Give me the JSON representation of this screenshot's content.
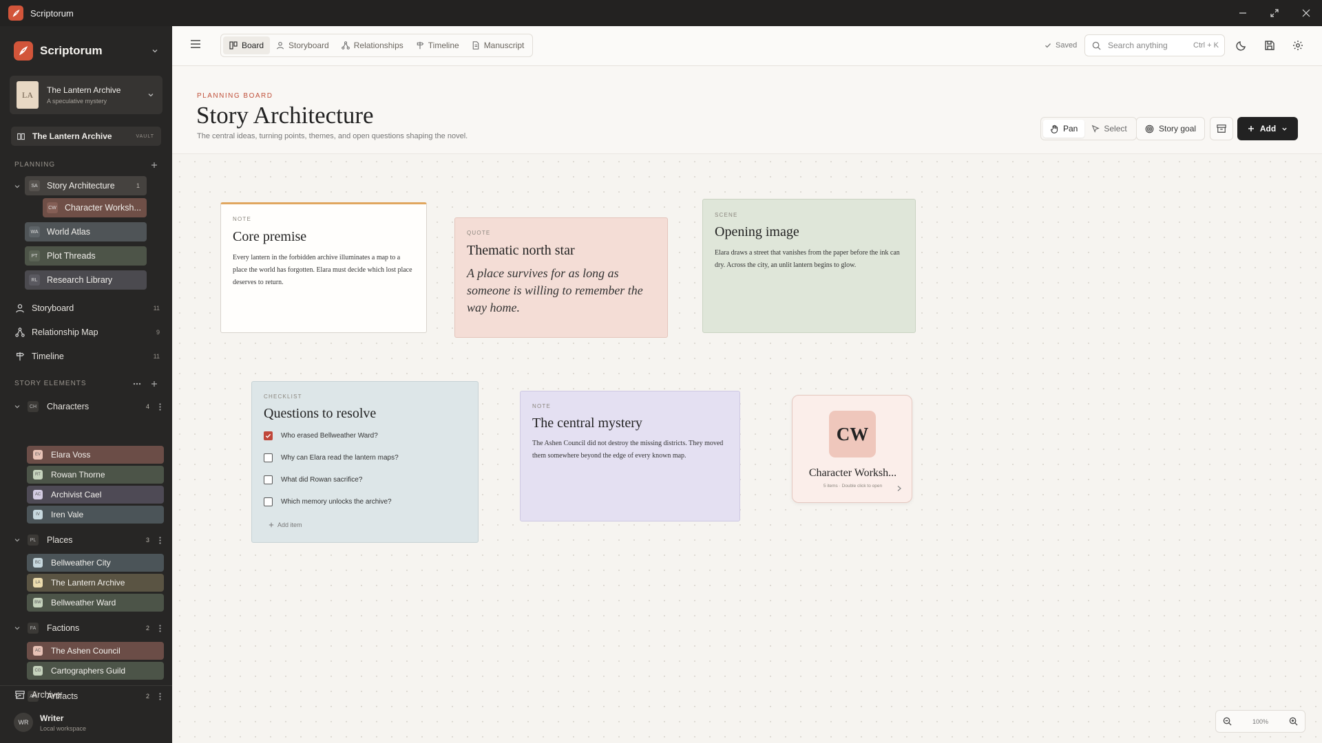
{
  "app": {
    "name": "Scriptorum"
  },
  "sidebar": {
    "brand": "Scriptorum",
    "project": {
      "initials": "LA",
      "title": "The Lantern Archive",
      "subtitle": "A speculative mystery"
    },
    "vault": {
      "label": "The Lantern Archive",
      "tag": "VAULT"
    },
    "planning": {
      "heading": "PLANNING",
      "root": {
        "initials": "SA",
        "label": "Story Architecture",
        "count": "1"
      },
      "child": {
        "initials": "CW",
        "label": "Character Worksh..."
      },
      "boards": [
        {
          "initials": "WA",
          "label": "World Atlas"
        },
        {
          "initials": "PT",
          "label": "Plot Threads"
        },
        {
          "initials": "RL",
          "label": "Research Library"
        }
      ]
    },
    "nav": [
      {
        "label": "Storyboard",
        "count": "11"
      },
      {
        "label": "Relationship Map",
        "count": "9"
      },
      {
        "label": "Timeline",
        "count": "11"
      }
    ],
    "story_elements": {
      "heading": "STORY ELEMENTS",
      "characters": {
        "initials": "CH",
        "label": "Characters",
        "count": "4",
        "items": [
          {
            "initials": "EV",
            "label": "Elara Voss"
          },
          {
            "initials": "RT",
            "label": "Rowan Thorne"
          },
          {
            "initials": "AC",
            "label": "Archivist Cael"
          },
          {
            "initials": "IV",
            "label": "Iren Vale"
          }
        ]
      },
      "places": {
        "initials": "PL",
        "label": "Places",
        "count": "3",
        "items": [
          {
            "initials": "BC",
            "label": "Bellweather City"
          },
          {
            "initials": "LA",
            "label": "The Lantern Archive"
          },
          {
            "initials": "BW",
            "label": "Bellweather Ward"
          }
        ]
      },
      "factions": {
        "initials": "FA",
        "label": "Factions",
        "count": "2",
        "items": [
          {
            "initials": "AC",
            "label": "The Ashen Council"
          },
          {
            "initials": "CG",
            "label": "Cartographers Guild"
          }
        ]
      },
      "artifacts": {
        "initials": "AR",
        "label": "Artifacts",
        "count": "2"
      }
    },
    "archive": "Archive",
    "user": {
      "initials": "WR",
      "name": "Writer",
      "workspace": "Local workspace"
    }
  },
  "toolbar": {
    "tabs": [
      {
        "label": "Board",
        "icon": "board-icon"
      },
      {
        "label": "Storyboard",
        "icon": "person-icon"
      },
      {
        "label": "Relationships",
        "icon": "network-icon"
      },
      {
        "label": "Timeline",
        "icon": "signpost-icon"
      },
      {
        "label": "Manuscript",
        "icon": "document-icon"
      }
    ],
    "saved": "Saved",
    "search_placeholder": "Search anything",
    "search_shortcut": "Ctrl + K"
  },
  "header": {
    "eyebrow": "PLANNING BOARD",
    "title": "Story Architecture",
    "subtitle": "The central ideas, turning points, themes, and open questions shaping the novel.",
    "pan": "Pan",
    "select": "Select",
    "story_goal": "Story goal",
    "add": "Add"
  },
  "cards": {
    "core_premise": {
      "kind": "NOTE",
      "title": "Core premise",
      "body": "Every lantern in the forbidden archive illuminates a map to a place the world has forgotten. Elara must decide which lost place deserves to return."
    },
    "thematic": {
      "kind": "QUOTE",
      "title": "Thematic north star",
      "quote": "A place survives for as long as someone is willing to remember the way home."
    },
    "opening": {
      "kind": "SCENE",
      "title": "Opening image",
      "body": "Elara draws a street that vanishes from the paper before the ink can dry. Across the city, an unlit lantern begins to glow."
    },
    "questions": {
      "kind": "CHECKLIST",
      "title": "Questions to resolve",
      "items": [
        {
          "label": "Who erased Bellweather Ward?",
          "checked": true
        },
        {
          "label": "Why can Elara read the lantern maps?",
          "checked": false
        },
        {
          "label": "What did Rowan sacrifice?",
          "checked": false
        },
        {
          "label": "Which memory unlocks the archive?",
          "checked": false
        }
      ],
      "add_item": "Add item"
    },
    "mystery": {
      "kind": "NOTE",
      "title": "The central mystery",
      "body": "The Ashen Council did not destroy the missing districts. They moved them somewhere beyond the edge of every known map."
    },
    "folder": {
      "initials": "CW",
      "title": "Character Worksh...",
      "meta": "5 items · Double click to open"
    }
  },
  "zoom": {
    "level": "100%"
  },
  "colors": {
    "accent": "#d2553a",
    "sidebar_bg": "#272625",
    "canvas_bg": "#f6f4f0"
  }
}
